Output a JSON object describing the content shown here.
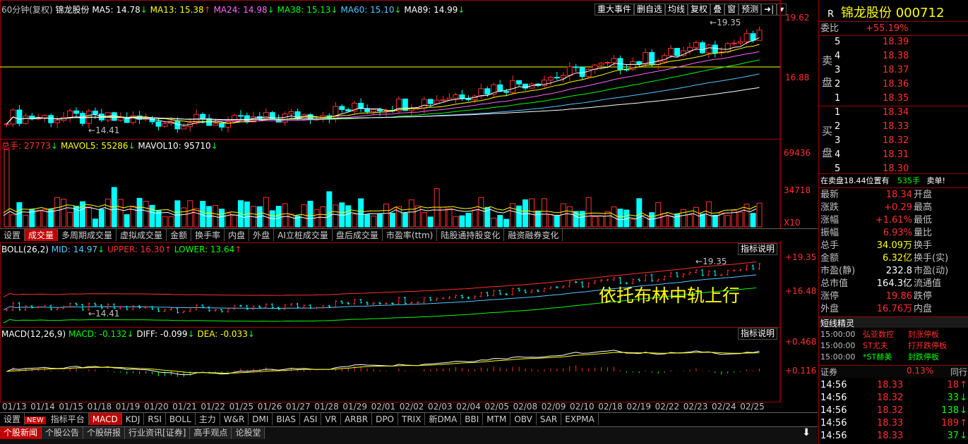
{
  "chart_header": {
    "period": "60分钟(复权)",
    "name": "锦龙股份",
    "ma5": "MA5: 14.78",
    "ma13": "MA13: 15.38",
    "ma24": "MA24: 14.98",
    "ma38": "MA38: 15.13",
    "ma60": "MA60: 15.10",
    "ma89": "MA89: 14.99"
  },
  "top_buttons": [
    "重大事件",
    "删自选",
    "均线",
    "复权",
    "叠",
    "窗",
    "预测"
  ],
  "price_axis": [
    "19.62",
    "16.88"
  ],
  "price_marks": {
    "high": "19.35",
    "low": "14.41"
  },
  "volume_header": {
    "total": "总手: 27773",
    "mavol5": "MAVOL5: 55286",
    "mavol10": "MAVOL10: 95710"
  },
  "volume_axis": [
    "69436",
    "34718",
    "X10"
  ],
  "mid_tabs": [
    "设置",
    "成交量",
    "多周期成交量",
    "虚拟成交量",
    "金额",
    "换手率",
    "内盘",
    "外盘",
    "AI立桩成交量",
    "盘后成交量",
    "市盈率(ttm)",
    "陆股通持股变化",
    "融资融券变化"
  ],
  "mid_active": "成交量",
  "boll_header": {
    "label": "BOLL(26,2)",
    "mid": "MID: 14.97",
    "upper": "UPPER: 16.30",
    "lower": "LOWER: 13.64"
  },
  "boll_axis": [
    "+19.35",
    "+16.48"
  ],
  "boll_marks": {
    "high": "19.35",
    "low": "14.41"
  },
  "boll_annotation": "依托布林中轨上行",
  "indicator_button": "指标说明",
  "macd_header": {
    "label": "MACD(12,26,9)",
    "macd": "MACD: -0.132",
    "diff": "DIFF: -0.099",
    "dea": "DEA: -0.033"
  },
  "macd_axis": [
    "+0.468",
    "+0.116"
  ],
  "dates": [
    "01/13",
    "01/14",
    "01/15",
    "01/18",
    "01/19",
    "01/20",
    "01/21",
    "01/22",
    "01/25",
    "01/26",
    "01/27",
    "01/28",
    "01/29",
    "02/01",
    "02/02",
    "02/03",
    "02/04",
    "02/05",
    "02/08",
    "02/09",
    "02/10",
    "02/18",
    "02/19",
    "02/22",
    "02/23",
    "02/24",
    "02/25"
  ],
  "bottom_tabs": [
    "设置",
    "指标平台",
    "MACD",
    "KDJ",
    "RSI",
    "BOLL",
    "主力",
    "W&R",
    "DMI",
    "BIAS",
    "ASI",
    "VR",
    "ARBR",
    "DPO",
    "TRIX",
    "新DMA",
    "BBI",
    "MTM",
    "OBV",
    "SAR",
    "EXPMA"
  ],
  "bottom_active": "MACD",
  "new_badge": "NEW",
  "news_tabs": [
    "个股新闻",
    "个股公告",
    "个股研报",
    "行业资讯[证券]",
    "高手观点",
    "论股堂"
  ],
  "news_active": "个股新闻",
  "right_panel": {
    "r_mark": "R",
    "title": "锦龙股份",
    "code": "000712",
    "weibi_label": "委比",
    "weibi": "+55.19%",
    "sell_label_1": "卖",
    "sell_label_2": "盘",
    "sells": [
      [
        "5",
        "18.39"
      ],
      [
        "4",
        "18.38"
      ],
      [
        "3",
        "18.37"
      ],
      [
        "2",
        "18.36"
      ],
      [
        "1",
        "18.35"
      ]
    ],
    "buy_label_1": "买",
    "buy_label_2": "盘",
    "buys": [
      [
        "1",
        "18.34"
      ],
      [
        "2",
        "18.33"
      ],
      [
        "3",
        "18.32"
      ],
      [
        "4",
        "18.31"
      ],
      [
        "5",
        "18.30"
      ]
    ],
    "position_text": "在卖盘18.44位置有",
    "position_qty": "535手",
    "position_action": "卖单!",
    "stats": [
      [
        "最新",
        "18.34",
        "开盘"
      ],
      [
        "涨跌",
        "+0.29",
        "最高"
      ],
      [
        "涨幅",
        "+1.61%",
        "最低"
      ],
      [
        "振幅",
        "6.93%",
        "量比"
      ],
      [
        "总手",
        "34.09万",
        "换手"
      ],
      [
        "金额",
        "6.32亿",
        "换手(实)"
      ],
      [
        "市盈(静)",
        "232.8",
        "市盈(动)"
      ],
      [
        "总市值",
        "164.3亿",
        "流通值"
      ],
      [
        "涨停",
        "19.86",
        "跌停"
      ],
      [
        "外盘",
        "16.76万",
        "内盘"
      ]
    ],
    "sprite_title": "短线精灵",
    "sprites": [
      [
        "15:00:00",
        "弘亚数控",
        "封涨停板"
      ],
      [
        "15:00:00",
        "ST尤夫",
        "打开跌停板"
      ],
      [
        "15:00:00",
        "*ST赫美",
        "封跌停板"
      ]
    ],
    "sector_label": "证券",
    "sector_pct": "0.13%",
    "sector_extra": "同行",
    "ticks": [
      [
        "14:56",
        "18.33",
        "18"
      ],
      [
        "14:56",
        "18.32",
        "33"
      ],
      [
        "14:56",
        "18.32",
        "138"
      ],
      [
        "14:56",
        "18.33",
        "189"
      ],
      [
        "14:56",
        "18.33",
        "37"
      ]
    ]
  },
  "colors": {
    "up": "#ff3030",
    "down": "#00ffff",
    "ma5": "#ffffff",
    "ma13": "#ffff00",
    "ma24": "#ff66ff",
    "ma38": "#00ff00",
    "ma60": "#54c8ff",
    "ma89": "#ffffff",
    "annotation": "#ffff00"
  }
}
